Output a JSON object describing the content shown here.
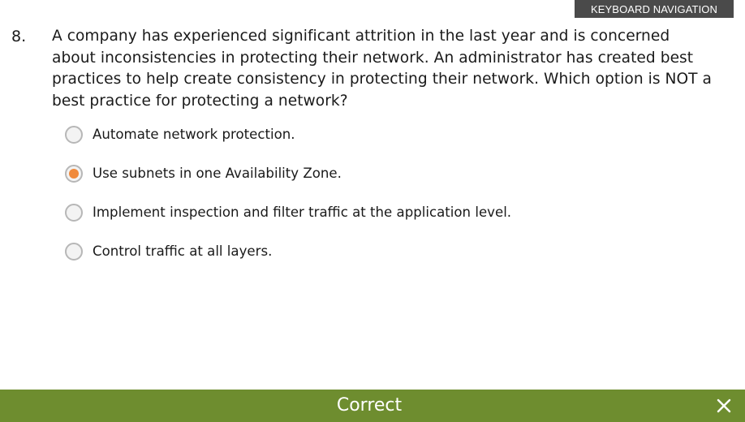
{
  "header": {
    "keyboard_nav_label": "KEYBOARD NAVIGATION"
  },
  "question": {
    "number": "8.",
    "text": "A company has experienced significant attrition in the last year and is concerned about inconsistencies in protecting their network. An administrator has created best practices to help create consistency in protecting their network. Which option is NOT a best practice for protecting a network?",
    "options": [
      {
        "label": "Automate network protection.",
        "selected": false
      },
      {
        "label": "Use subnets in one Availability Zone.",
        "selected": true
      },
      {
        "label": "Implement inspection and filter traffic at the application level.",
        "selected": false
      },
      {
        "label": "Control traffic at all layers.",
        "selected": false
      }
    ]
  },
  "feedback": {
    "status": "Correct",
    "close_icon": "close-icon"
  },
  "colors": {
    "accent": "#f08a3c",
    "feedback_bg": "#6e8d2f",
    "header_bg": "#4a4a4a"
  }
}
